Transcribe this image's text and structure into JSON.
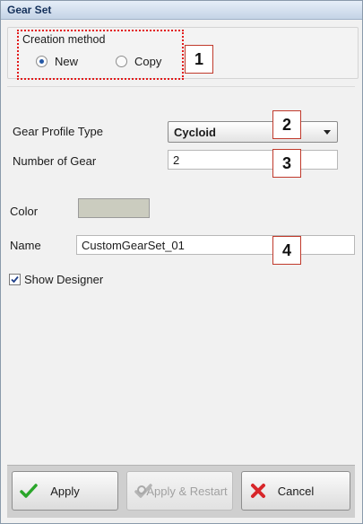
{
  "window": {
    "title": "Gear Set"
  },
  "creation": {
    "legend": "Creation method",
    "options": [
      {
        "label": "New",
        "selected": true
      },
      {
        "label": "Copy",
        "selected": false
      }
    ]
  },
  "callouts": [
    "1",
    "2",
    "3",
    "4"
  ],
  "profile_type": {
    "label": "Gear Profile Type",
    "value": "Cycloid"
  },
  "number_of_gear": {
    "label": "Number of Gear",
    "value": "2"
  },
  "color": {
    "label": "Color",
    "value": "#cbccbf"
  },
  "name": {
    "label": "Name",
    "value": "CustomGearSet_01"
  },
  "show_designer": {
    "label": "Show Designer",
    "checked": true
  },
  "buttons": {
    "apply": "Apply",
    "apply_restart": "Apply & Restart",
    "cancel": "Cancel"
  }
}
